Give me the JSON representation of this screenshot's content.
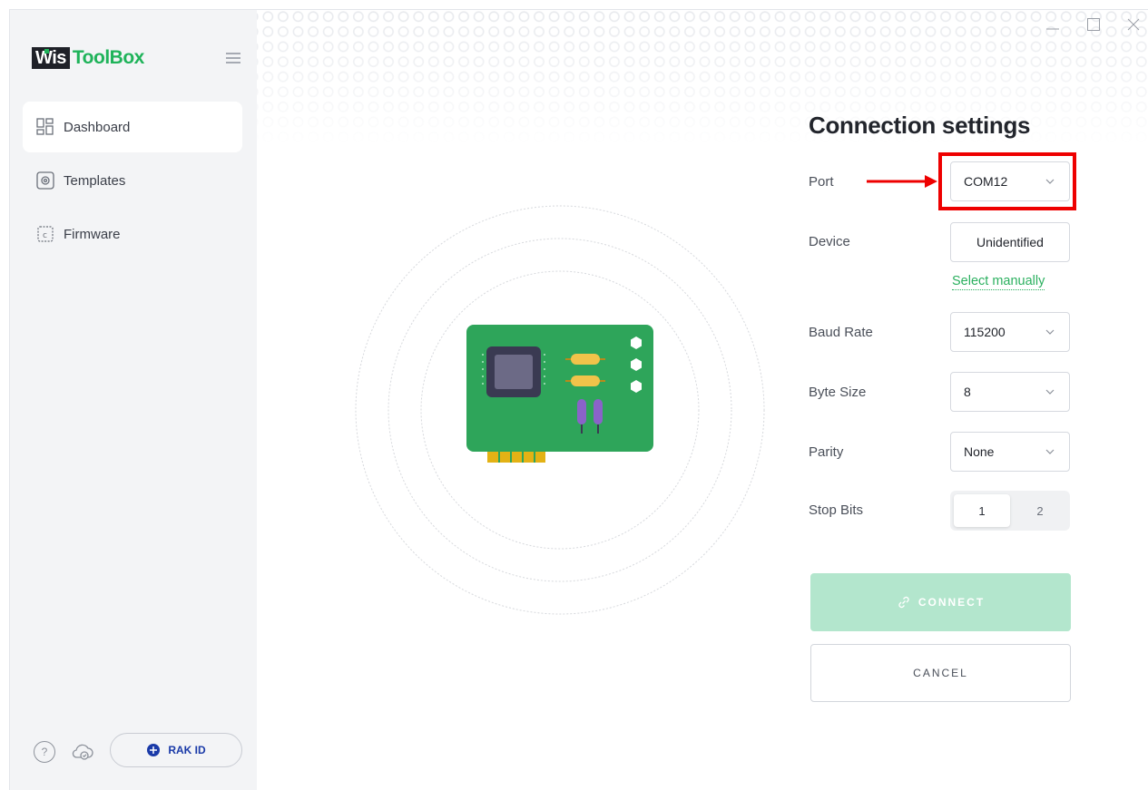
{
  "app": {
    "logo_wis": "Wis",
    "logo_toolbox": "ToolBox"
  },
  "sidebar": {
    "items": [
      {
        "label": "Dashboard",
        "icon": "dashboard-icon",
        "active": true
      },
      {
        "label": "Templates",
        "icon": "templates-icon",
        "active": false
      },
      {
        "label": "Firmware",
        "icon": "firmware-icon",
        "active": false
      }
    ],
    "help_label": "?",
    "rak_id_label": "RAK ID"
  },
  "window_controls": [
    "minimize-icon",
    "maximize-icon",
    "close-icon"
  ],
  "settings": {
    "title": "Connection settings",
    "port": {
      "label": "Port",
      "value": "COM12"
    },
    "device": {
      "label": "Device",
      "value": "Unidentified",
      "link": "Select manually"
    },
    "baud_rate": {
      "label": "Baud Rate",
      "value": "115200"
    },
    "byte_size": {
      "label": "Byte Size",
      "value": "8"
    },
    "parity": {
      "label": "Parity",
      "value": "None"
    },
    "stop_bits": {
      "label": "Stop Bits",
      "options": [
        "1",
        "2"
      ],
      "selected": "1"
    },
    "connect_label": "CONNECT",
    "cancel_label": "CANCEL"
  },
  "colors": {
    "accent": "#1fb35a",
    "connect_disabled": "#b3e6cd",
    "highlight": "#ee0000",
    "sidebar_bg": "#f3f4f6",
    "board": "#2ea55a"
  }
}
